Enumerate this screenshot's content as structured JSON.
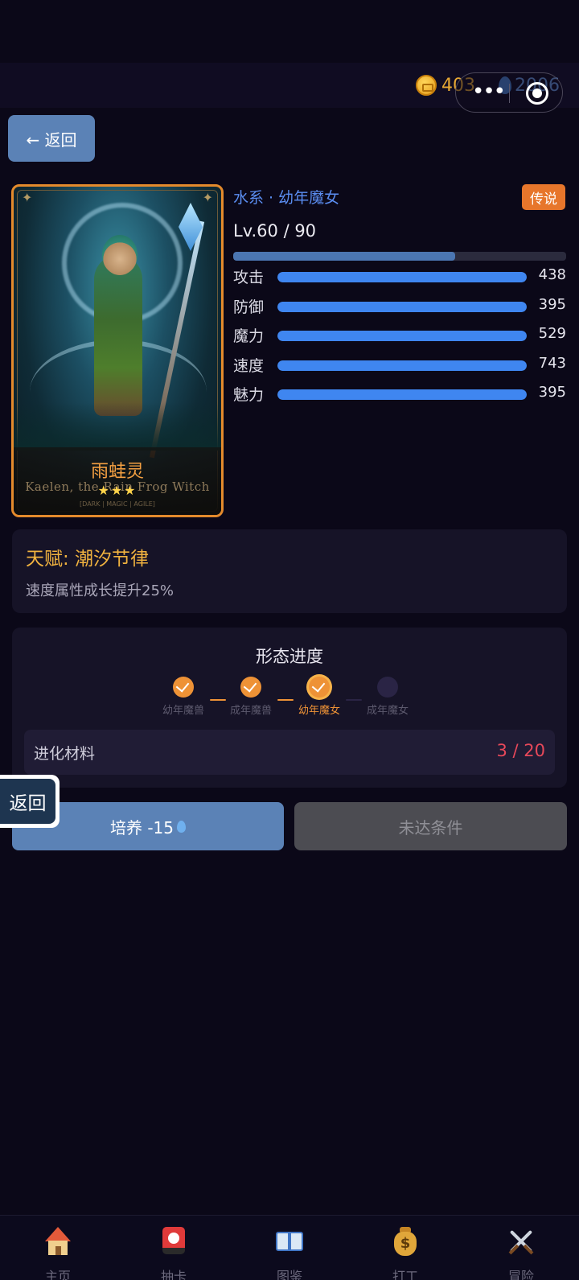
{
  "header": {
    "coins": "403",
    "water": "2006",
    "back_label": "← 返回"
  },
  "character": {
    "name_cn": "雨蛙灵",
    "name_en": "Kaelen, the Rain Frog Witch",
    "stars": "★★★",
    "card_tags": "[DARK | MAGIC | AGILE]",
    "type_line": "水系 · 幼年魔女",
    "rarity": "传说",
    "level_text": "Lv.60 / 90",
    "level": 60,
    "level_max": 90,
    "stats": [
      {
        "label": "攻击",
        "value": "438",
        "fill": 1.0
      },
      {
        "label": "防御",
        "value": "395",
        "fill": 1.0
      },
      {
        "label": "魔力",
        "value": "529",
        "fill": 1.0
      },
      {
        "label": "速度",
        "value": "743",
        "fill": 1.0
      },
      {
        "label": "魅力",
        "value": "395",
        "fill": 1.0
      }
    ]
  },
  "talent": {
    "title": "天赋: 潮汐节律",
    "desc": "速度属性成长提升25%"
  },
  "form_progress": {
    "title": "形态进度",
    "stages": [
      {
        "label": "幼年魔兽",
        "state": "done"
      },
      {
        "label": "成年魔兽",
        "state": "done"
      },
      {
        "label": "幼年魔女",
        "state": "current"
      },
      {
        "label": "成年魔女",
        "state": "todo"
      }
    ],
    "material_label": "进化材料",
    "material_count": "3 / 20"
  },
  "actions": {
    "float_back": "返回",
    "train_label": "培养 -15",
    "evolve_label": "未达条件"
  },
  "tabbar": {
    "items": [
      {
        "label": "主页",
        "icon": "home-icon"
      },
      {
        "label": "抽卡",
        "icon": "card-draw-icon"
      },
      {
        "label": "图鉴",
        "icon": "book-icon"
      },
      {
        "label": "打工",
        "icon": "money-bag-icon"
      },
      {
        "label": "冒险",
        "icon": "crossed-swords-icon"
      }
    ]
  },
  "colors": {
    "accent": "#5b82b6",
    "rarity": "#e7762b",
    "stat_bar": "#3f86f0",
    "talent_title": "#f0b23f",
    "material_count": "#e7485a"
  }
}
